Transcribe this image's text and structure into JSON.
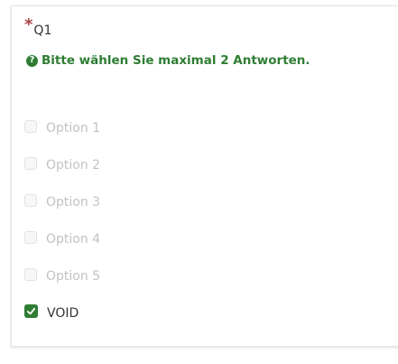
{
  "question": {
    "required_marker": "*",
    "code": "Q1",
    "hint": "Bitte wählen Sie maximal 2 Antworten.",
    "hint_icon": "question-circle-icon"
  },
  "options": [
    {
      "label": "Option 1",
      "checked": false,
      "disabled": true
    },
    {
      "label": "Option 2",
      "checked": false,
      "disabled": true
    },
    {
      "label": "Option 3",
      "checked": false,
      "disabled": true
    },
    {
      "label": "Option 4",
      "checked": false,
      "disabled": true
    },
    {
      "label": "Option 5",
      "checked": false,
      "disabled": true
    },
    {
      "label": "VOID",
      "checked": true,
      "disabled": false
    }
  ],
  "colors": {
    "accent": "#2e7d32",
    "required": "#a94442",
    "disabled_text": "#c2c2c2",
    "text": "#333333"
  }
}
